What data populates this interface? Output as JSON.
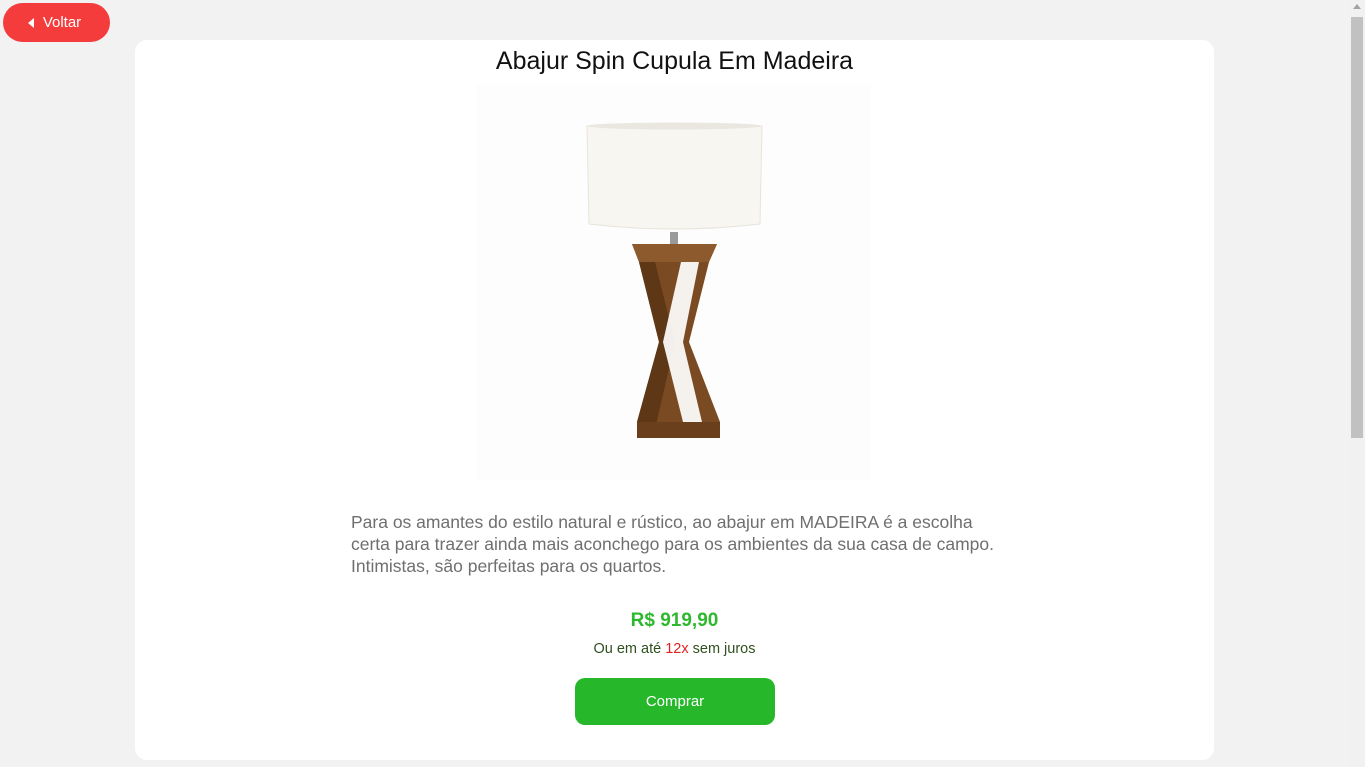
{
  "nav": {
    "back_label": "Voltar",
    "back_icon": "caret-left-icon"
  },
  "product": {
    "title": "Abajur Spin Cupula Em Madeira",
    "description": "Para os amantes do estilo natural e rústico, ao abajur em MADEIRA é a escolha certa para trazer ainda mais aconchego para os ambientes da sua casa de campo. Intimistas, são perfeitas para os quartos.",
    "price": "R$ 919,90",
    "installments_prefix": "Ou em até",
    "installments_count": "12x",
    "installments_suffix": "sem juros",
    "buy_label": "Comprar"
  },
  "colors": {
    "back_button": "#f53c3c",
    "price": "#2db82d",
    "buy_button": "#26b82a",
    "installments_count": "#e21f1f"
  }
}
